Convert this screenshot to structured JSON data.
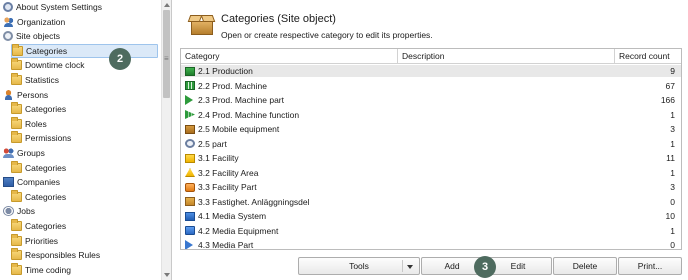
{
  "tree": {
    "items": [
      {
        "label": "About System Settings",
        "icon": "gear-icon",
        "level": 0
      },
      {
        "label": "Organization",
        "icon": "users-icon",
        "level": 0
      },
      {
        "label": "Site objects",
        "icon": "magnet-icon",
        "level": 0
      },
      {
        "label": "Categories",
        "icon": "folder-icon",
        "level": 1,
        "selected": true
      },
      {
        "label": "Downtime clock",
        "icon": "folder-icon",
        "level": 1
      },
      {
        "label": "Statistics",
        "icon": "folder-icon",
        "level": 1
      },
      {
        "label": "Persons",
        "icon": "persons-icon",
        "level": 0
      },
      {
        "label": "Categories",
        "icon": "folder-icon",
        "level": 1
      },
      {
        "label": "Roles",
        "icon": "folder-icon",
        "level": 1
      },
      {
        "label": "Permissions",
        "icon": "folder-icon",
        "level": 1
      },
      {
        "label": "Groups",
        "icon": "groups-icon",
        "level": 0
      },
      {
        "label": "Categories",
        "icon": "folder-icon",
        "level": 1
      },
      {
        "label": "Companies",
        "icon": "companies-icon",
        "level": 0
      },
      {
        "label": "Categories",
        "icon": "folder-icon",
        "level": 1
      },
      {
        "label": "Jobs",
        "icon": "jobs-icon",
        "level": 0
      },
      {
        "label": "Categories",
        "icon": "folder-icon",
        "level": 1
      },
      {
        "label": "Priorities",
        "icon": "folder-icon",
        "level": 1
      },
      {
        "label": "Responsibles Rules",
        "icon": "folder-icon",
        "level": 1
      },
      {
        "label": "Time coding",
        "icon": "folder-icon",
        "level": 1
      }
    ]
  },
  "badges": {
    "b2": "2",
    "b3": "3"
  },
  "splitter_grip": "≡",
  "header": {
    "title": "Categories (Site object)",
    "description": "Open or create respective category to edit its properties."
  },
  "grid": {
    "columns": [
      "Category",
      "Description",
      "Record count"
    ],
    "rows": [
      {
        "name": "2.1 Production",
        "description": "",
        "count": "9",
        "icon": "production-icon"
      },
      {
        "name": "2.2 Prod. Machine",
        "description": "",
        "count": "67",
        "icon": "machine-icon"
      },
      {
        "name": "2.3 Prod. Machine part",
        "description": "",
        "count": "166",
        "icon": "machine-part-icon"
      },
      {
        "name": "2.4 Prod. Machine function",
        "description": "",
        "count": "1",
        "icon": "machine-function-icon"
      },
      {
        "name": "2.5 Mobile equipment",
        "description": "",
        "count": "3",
        "icon": "mobile-equipment-icon"
      },
      {
        "name": "2.5 part",
        "description": "",
        "count": "1",
        "icon": "part-icon"
      },
      {
        "name": "3.1 Facility",
        "description": "",
        "count": "11",
        "icon": "facility-icon"
      },
      {
        "name": "3.2 Facility Area",
        "description": "",
        "count": "1",
        "icon": "facility-area-icon"
      },
      {
        "name": "3.3 Facility Part",
        "description": "",
        "count": "3",
        "icon": "facility-part-icon"
      },
      {
        "name": "3.3 Fastighet. Anläggningsdel",
        "description": "",
        "count": "0",
        "icon": "anlaggningsdel-icon"
      },
      {
        "name": "4.1 Media System",
        "description": "",
        "count": "10",
        "icon": "media-system-icon"
      },
      {
        "name": "4.2 Media Equipment",
        "description": "",
        "count": "1",
        "icon": "media-equipment-icon"
      },
      {
        "name": "4.3 Media Part",
        "description": "",
        "count": "0",
        "icon": "media-part-icon"
      }
    ]
  },
  "buttons": {
    "tools": "Tools",
    "add": "Add",
    "edit": "Edit",
    "delete": "Delete",
    "print": "Print..."
  }
}
